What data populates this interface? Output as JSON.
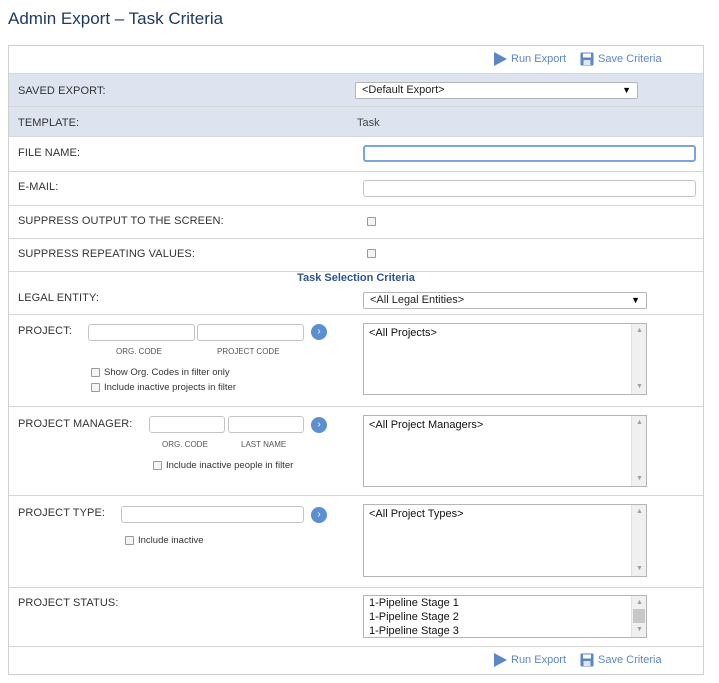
{
  "page": {
    "title": "Admin Export – Task Criteria"
  },
  "toolbar": {
    "run_export": "Run Export",
    "save_criteria": "Save Criteria"
  },
  "fields": {
    "saved_export": {
      "label": "SAVED EXPORT:",
      "value": "<Default Export>"
    },
    "template": {
      "label": "TEMPLATE:",
      "value": "Task"
    },
    "file_name": {
      "label": "FILE NAME:",
      "value": ""
    },
    "email": {
      "label": "E-MAIL:",
      "value": ""
    },
    "suppress_output": {
      "label": "SUPPRESS OUTPUT TO THE SCREEN:",
      "checked": false
    },
    "suppress_repeating": {
      "label": "SUPPRESS REPEATING VALUES:",
      "checked": false
    }
  },
  "section": {
    "title": "Task Selection Criteria"
  },
  "legal_entity": {
    "label": "LEGAL ENTITY:",
    "value": "<All Legal Entities>"
  },
  "project": {
    "label": "PROJECT:",
    "org_code_caption": "ORG. CODE",
    "project_code_caption": "PROJECT CODE",
    "show_org_codes": "Show Org. Codes in filter only",
    "include_inactive": "Include inactive projects in filter",
    "list": [
      "<All Projects>"
    ]
  },
  "project_manager": {
    "label": "PROJECT MANAGER:",
    "org_code_caption": "ORG. CODE",
    "last_name_caption": "LAST NAME",
    "include_inactive": "Include inactive people in filter",
    "list": [
      "<All Project Managers>"
    ]
  },
  "project_type": {
    "label": "PROJECT TYPE:",
    "include_inactive": "Include inactive",
    "list": [
      "<All Project Types>"
    ]
  },
  "project_status": {
    "label": "PROJECT STATUS:",
    "list": [
      "1-Pipeline Stage 1",
      "1-Pipeline Stage 2",
      "1-Pipeline Stage 3"
    ]
  },
  "icons": {
    "run": "play-icon",
    "save": "floppy-disk-icon",
    "go": "arrow-right-circle-icon",
    "dropdown": "caret-down-icon",
    "scroll_up": "scroll-up-arrow-icon",
    "scroll_down": "scroll-down-arrow-icon"
  },
  "colors": {
    "accent": "#5b87c2",
    "header_band": "#dde3ef",
    "title": "#1f3a60"
  }
}
